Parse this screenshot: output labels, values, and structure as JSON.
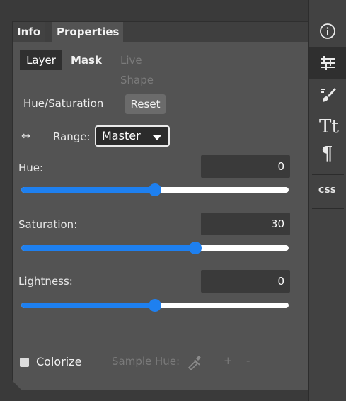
{
  "panel": {
    "tabs": [
      "Info",
      "Properties"
    ],
    "subtabs": [
      "Layer",
      "Mask",
      "Live Shape"
    ]
  },
  "adjustment": {
    "title": "Hue/Saturation",
    "reset_label": "Reset",
    "range_label": "Range:",
    "range_value": "Master"
  },
  "fields": [
    {
      "label": "Hue:",
      "value": "0",
      "slider_fraction": 0.5
    },
    {
      "label": "Saturation:",
      "value": "30",
      "slider_fraction": 0.65
    },
    {
      "label": "Lightness:",
      "value": "0",
      "slider_fraction": 0.5
    }
  ],
  "options": {
    "colorize_label": "Colorize",
    "colorize_checked": false,
    "sample_hue_label": "Sample Hue:",
    "plus_label": "+",
    "minus_label": "-"
  },
  "sidebar": {
    "icons": [
      "info-icon",
      "adjustments-icon",
      "brush-icon",
      "text-icon",
      "paragraph-icon",
      "css-icon"
    ],
    "css_label": "CSS",
    "tt_label": "Tt",
    "paragraph_label": "¶"
  },
  "colors": {
    "accent": "#1e80f0",
    "panel_bg": "#535353",
    "sidebar_bg": "#424242"
  }
}
